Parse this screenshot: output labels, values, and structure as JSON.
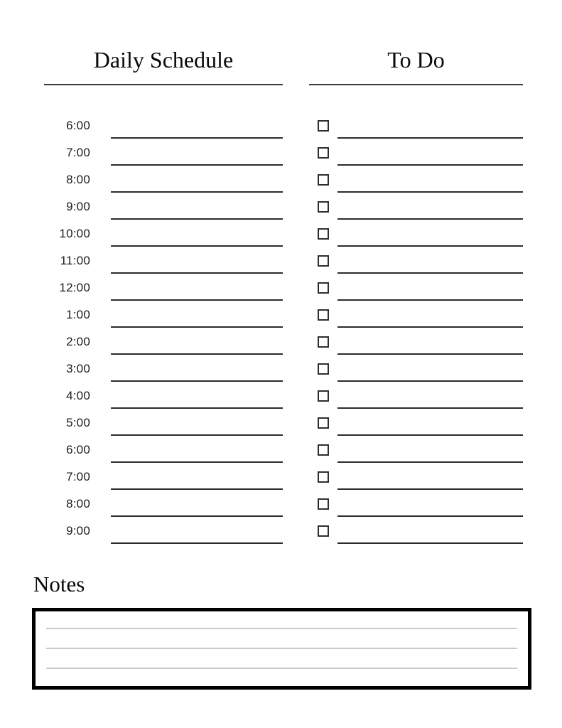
{
  "page": {
    "background": "#ffffff",
    "ink": "#000000",
    "rule_color": "#2b2b2b",
    "notes_rule_color": "#c9c9c9"
  },
  "schedule": {
    "heading": "Daily Schedule",
    "rows": [
      {
        "time": "6:00"
      },
      {
        "time": "7:00"
      },
      {
        "time": "8:00"
      },
      {
        "time": "9:00"
      },
      {
        "time": "10:00"
      },
      {
        "time": "11:00"
      },
      {
        "time": "12:00"
      },
      {
        "time": "1:00"
      },
      {
        "time": "2:00"
      },
      {
        "time": "3:00"
      },
      {
        "time": "4:00"
      },
      {
        "time": "5:00"
      },
      {
        "time": "6:00"
      },
      {
        "time": "7:00"
      },
      {
        "time": "8:00"
      },
      {
        "time": "9:00"
      }
    ]
  },
  "todo": {
    "heading": "To Do",
    "rows": [
      {
        "checked": false,
        "text": ""
      },
      {
        "checked": false,
        "text": ""
      },
      {
        "checked": false,
        "text": ""
      },
      {
        "checked": false,
        "text": ""
      },
      {
        "checked": false,
        "text": ""
      },
      {
        "checked": false,
        "text": ""
      },
      {
        "checked": false,
        "text": ""
      },
      {
        "checked": false,
        "text": ""
      },
      {
        "checked": false,
        "text": ""
      },
      {
        "checked": false,
        "text": ""
      },
      {
        "checked": false,
        "text": ""
      },
      {
        "checked": false,
        "text": ""
      },
      {
        "checked": false,
        "text": ""
      },
      {
        "checked": false,
        "text": ""
      },
      {
        "checked": false,
        "text": ""
      },
      {
        "checked": false,
        "text": ""
      }
    ]
  },
  "notes": {
    "heading": "Notes",
    "lines": [
      "",
      "",
      ""
    ]
  }
}
